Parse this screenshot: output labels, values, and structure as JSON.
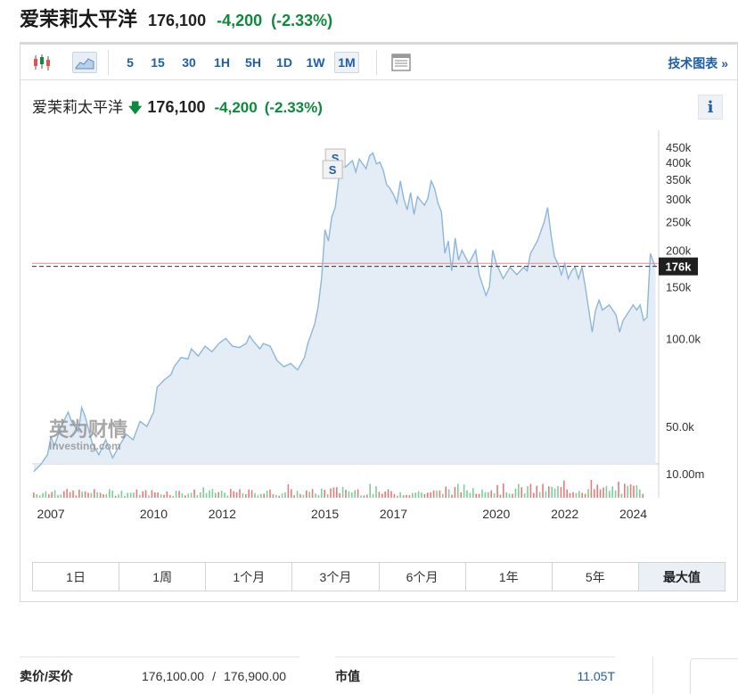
{
  "header": {
    "title": "爱茉莉太平洋",
    "price": "176,100",
    "change": "-4,200",
    "change_pct": "(-2.33%)"
  },
  "toolbar": {
    "intervals": [
      "5",
      "15",
      "30",
      "1H",
      "5H",
      "1D",
      "1W",
      "1M"
    ],
    "active_interval": "1M",
    "tech_chart_label": "技术图表 »",
    "icons": [
      "candlestick-icon",
      "area-chart-icon",
      "table-view-icon"
    ]
  },
  "chart_header": {
    "name": "爱茉莉太平洋",
    "arrow": "🡇",
    "price": "176,100",
    "change": "-4,200",
    "change_pct": "(-2.33%)",
    "info_label": "i"
  },
  "colors": {
    "up": "#0e8a3c",
    "down": "#e05252",
    "line": "#8db7da",
    "area": "#e4edf6",
    "link": "#1e5fa8"
  },
  "chart_data": {
    "type": "area",
    "scale": "log",
    "y_ticks": [
      {
        "label": "450k",
        "value": 450000
      },
      {
        "label": "400k",
        "value": 400000
      },
      {
        "label": "350k",
        "value": 350000
      },
      {
        "label": "300k",
        "value": 300000
      },
      {
        "label": "250k",
        "value": 250000
      },
      {
        "label": "200k",
        "value": 200000
      },
      {
        "label": "150k",
        "value": 150000
      },
      {
        "label": "100.0k",
        "value": 100000
      },
      {
        "label": "50.0k",
        "value": 50000
      }
    ],
    "volume_tick": "10.00m",
    "x_ticks": [
      {
        "label": "2007",
        "value": 2007.0
      },
      {
        "label": "2010",
        "value": 2010.0
      },
      {
        "label": "2012",
        "value": 2012.0
      },
      {
        "label": "2015",
        "value": 2015.0
      },
      {
        "label": "2017",
        "value": 2017.0
      },
      {
        "label": "2020",
        "value": 2020.0
      },
      {
        "label": "2022",
        "value": 2022.0
      },
      {
        "label": "2024",
        "value": 2024.0
      }
    ],
    "current_price_label": "176k",
    "current_price": 176100,
    "prev_close": 180300,
    "split_markers": [
      {
        "label": "S",
        "x": 2015.3
      },
      {
        "label": "S",
        "x": 2015.3
      }
    ],
    "series": [
      {
        "points": [
          [
            2006.5,
            35000
          ],
          [
            2006.7,
            37000
          ],
          [
            2006.9,
            40000
          ],
          [
            2007.0,
            46000
          ],
          [
            2007.1,
            43000
          ],
          [
            2007.3,
            50000
          ],
          [
            2007.5,
            56000
          ],
          [
            2007.6,
            52000
          ],
          [
            2007.8,
            48000
          ],
          [
            2007.9,
            58000
          ],
          [
            2008.0,
            54000
          ],
          [
            2008.2,
            44000
          ],
          [
            2008.4,
            40000
          ],
          [
            2008.6,
            45000
          ],
          [
            2008.8,
            39000
          ],
          [
            2009.0,
            43000
          ],
          [
            2009.2,
            47000
          ],
          [
            2009.4,
            45000
          ],
          [
            2009.6,
            52000
          ],
          [
            2009.8,
            50000
          ],
          [
            2010.0,
            56000
          ],
          [
            2010.1,
            68000
          ],
          [
            2010.3,
            72000
          ],
          [
            2010.5,
            75000
          ],
          [
            2010.6,
            80000
          ],
          [
            2010.8,
            86000
          ],
          [
            2011.0,
            85000
          ],
          [
            2011.1,
            92000
          ],
          [
            2011.3,
            87000
          ],
          [
            2011.5,
            94000
          ],
          [
            2011.7,
            90000
          ],
          [
            2011.9,
            96000
          ],
          [
            2012.1,
            100000
          ],
          [
            2012.3,
            94000
          ],
          [
            2012.5,
            93000
          ],
          [
            2012.7,
            96000
          ],
          [
            2012.8,
            102000
          ],
          [
            2012.9,
            98000
          ],
          [
            2013.1,
            92000
          ],
          [
            2013.2,
            96000
          ],
          [
            2013.4,
            94000
          ],
          [
            2013.6,
            84000
          ],
          [
            2013.8,
            80000
          ],
          [
            2014.0,
            82000
          ],
          [
            2014.2,
            78000
          ],
          [
            2014.4,
            86000
          ],
          [
            2014.5,
            96000
          ],
          [
            2014.7,
            112000
          ],
          [
            2014.8,
            128000
          ],
          [
            2014.9,
            160000
          ],
          [
            2015.0,
            235000
          ],
          [
            2015.1,
            215000
          ],
          [
            2015.2,
            260000
          ],
          [
            2015.3,
            280000
          ],
          [
            2015.4,
            350000
          ],
          [
            2015.5,
            410000
          ],
          [
            2015.6,
            385000
          ],
          [
            2015.7,
            395000
          ],
          [
            2015.8,
            405000
          ],
          [
            2015.9,
            370000
          ],
          [
            2016.0,
            410000
          ],
          [
            2016.1,
            395000
          ],
          [
            2016.2,
            380000
          ],
          [
            2016.3,
            420000
          ],
          [
            2016.4,
            430000
          ],
          [
            2016.5,
            395000
          ],
          [
            2016.6,
            400000
          ],
          [
            2016.7,
            375000
          ],
          [
            2016.8,
            335000
          ],
          [
            2016.9,
            325000
          ],
          [
            2017.0,
            310000
          ],
          [
            2017.1,
            290000
          ],
          [
            2017.2,
            345000
          ],
          [
            2017.3,
            300000
          ],
          [
            2017.4,
            275000
          ],
          [
            2017.5,
            315000
          ],
          [
            2017.6,
            265000
          ],
          [
            2017.7,
            305000
          ],
          [
            2017.8,
            295000
          ],
          [
            2017.9,
            285000
          ],
          [
            2018.0,
            300000
          ],
          [
            2018.1,
            345000
          ],
          [
            2018.2,
            325000
          ],
          [
            2018.3,
            290000
          ],
          [
            2018.4,
            270000
          ],
          [
            2018.5,
            195000
          ],
          [
            2018.6,
            215000
          ],
          [
            2018.7,
            170000
          ],
          [
            2018.8,
            220000
          ],
          [
            2018.9,
            185000
          ],
          [
            2019.0,
            200000
          ],
          [
            2019.2,
            180000
          ],
          [
            2019.4,
            200000
          ],
          [
            2019.5,
            165000
          ],
          [
            2019.7,
            140000
          ],
          [
            2019.8,
            150000
          ],
          [
            2019.9,
            200000
          ],
          [
            2020.0,
            180000
          ],
          [
            2020.1,
            170000
          ],
          [
            2020.2,
            160000
          ],
          [
            2020.4,
            175000
          ],
          [
            2020.6,
            165000
          ],
          [
            2020.8,
            175000
          ],
          [
            2020.9,
            170000
          ],
          [
            2021.0,
            195000
          ],
          [
            2021.2,
            215000
          ],
          [
            2021.4,
            250000
          ],
          [
            2021.5,
            280000
          ],
          [
            2021.6,
            225000
          ],
          [
            2021.7,
            190000
          ],
          [
            2021.8,
            180000
          ],
          [
            2021.9,
            165000
          ],
          [
            2022.0,
            180000
          ],
          [
            2022.1,
            160000
          ],
          [
            2022.2,
            170000
          ],
          [
            2022.3,
            175000
          ],
          [
            2022.4,
            160000
          ],
          [
            2022.5,
            175000
          ],
          [
            2022.6,
            150000
          ],
          [
            2022.7,
            125000
          ],
          [
            2022.8,
            105000
          ],
          [
            2022.9,
            125000
          ],
          [
            2023.0,
            135000
          ],
          [
            2023.1,
            125000
          ],
          [
            2023.3,
            130000
          ],
          [
            2023.5,
            120000
          ],
          [
            2023.6,
            105000
          ],
          [
            2023.7,
            115000
          ],
          [
            2023.9,
            125000
          ],
          [
            2024.0,
            130000
          ],
          [
            2024.1,
            125000
          ],
          [
            2024.2,
            130000
          ],
          [
            2024.3,
            115000
          ],
          [
            2024.4,
            118000
          ],
          [
            2024.5,
            195000
          ],
          [
            2024.6,
            180000
          ],
          [
            2024.65,
            176100
          ]
        ]
      }
    ],
    "volume_monthly_hint": "mixed red/green bars, heavier after 2019"
  },
  "ranges": [
    "1日",
    "1周",
    "1个月",
    "3个月",
    "6个月",
    "1年",
    "5年",
    "最大值"
  ],
  "active_range": "最大值",
  "bottom": {
    "bid_ask_label": "卖价/买价",
    "bid": "176,100.00",
    "separator": "/",
    "ask": "176,900.00",
    "market_cap_label": "市值",
    "market_cap": "11.05T"
  },
  "watermark": {
    "cn": "英为财情",
    "en": "Investing.com"
  }
}
